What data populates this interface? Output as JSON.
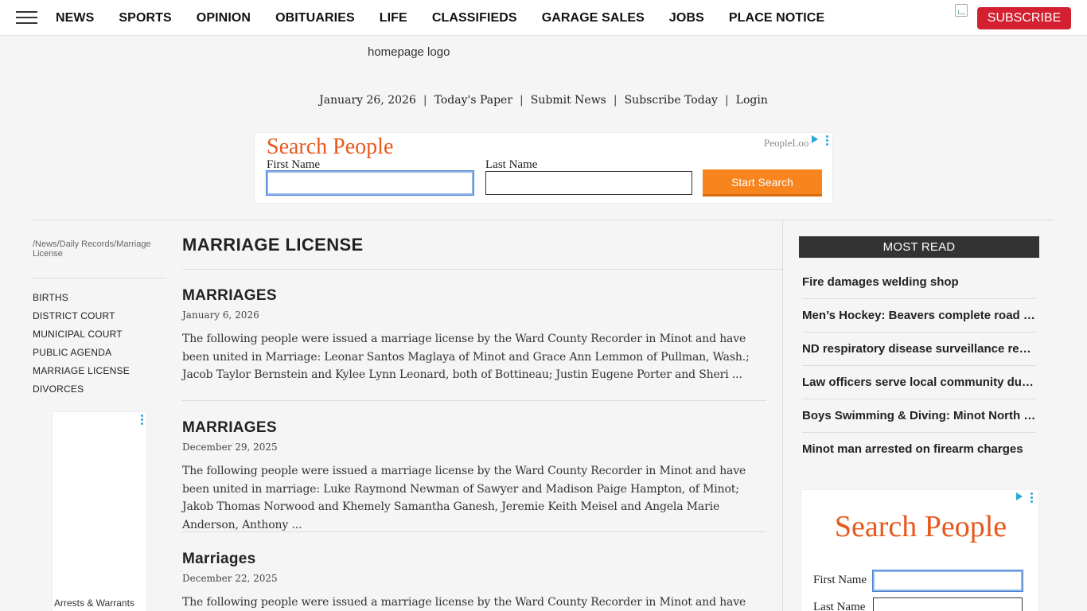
{
  "nav": {
    "items": [
      "NEWS",
      "SPORTS",
      "OPINION",
      "OBITUARIES",
      "LIFE",
      "CLASSIFIEDS",
      "GARAGE SALES",
      "JOBS",
      "PLACE NOTICE"
    ],
    "subscribe_label": "SUBSCRIBE"
  },
  "logo_alt": "homepage logo",
  "dateline": {
    "date": "January 26, 2026",
    "links": [
      "Today's Paper",
      "Submit News",
      "Subscribe Today",
      "Login"
    ]
  },
  "top_ad": {
    "title": "Search People",
    "brand": "PeopleLoo",
    "first_name_label": "First Name",
    "last_name_label": "Last Name",
    "first_name_value": "",
    "last_name_value": "",
    "button_label": "Start Search"
  },
  "breadcrumb": [
    "/News",
    "/Daily Records",
    "/Marriage License"
  ],
  "sidebar": {
    "items": [
      "BIRTHS",
      "DISTRICT COURT",
      "MUNICIPAL COURT",
      "PUBLIC AGENDA",
      "MARRIAGE LICENSE",
      "DIVORCES"
    ],
    "ad_caption": "Arrests & Warrants"
  },
  "page_title": "MARRIAGE LICENSE",
  "articles": [
    {
      "title": "MARRIAGES",
      "date": "January 6, 2026",
      "excerpt": "The following people were issued a marriage license by the Ward County Recorder in Minot and have been united in Marriage: Leonar Santos Maglaya of Minot and Grace Ann Lemmon of Pullman, Wash.; Jacob Taylor Bernstein and Kylee Lynn Leonard, both of Bottineau; Justin Eugene Porter and Sheri ..."
    },
    {
      "title": "MARRIAGES",
      "date": "December 29, 2025",
      "excerpt": "The following people were issued a marriage license by the Ward County Recorder in Minot and have been united in marriage: Luke Raymond Newman of Sawyer and Madison Paige Hampton, of Minot; Jakob Thomas Norwood and Khemely Samantha Ganesh, Jeremie Keith Meisel and Angela Marie Anderson, Anthony ..."
    },
    {
      "title": "Marriages",
      "date": "December 22, 2025",
      "excerpt": "The following people were issued a marriage license by the Ward County Recorder in Minot and have been"
    }
  ],
  "most_read": {
    "heading": "MOST READ",
    "items": [
      "Fire damages welding shop",
      "Men’s Hockey: Beavers complete road sweep",
      "ND respiratory disease surveillance report",
      "Law officers serve local community during holidays",
      "Boys Swimming & Diving: Minot North takes title",
      "Minot man arrested on firearm charges"
    ]
  },
  "right_ad": {
    "title": "Search People",
    "first_name_label": "First Name",
    "last_name_label": "Last Name"
  },
  "colors": {
    "subscribe": "#d22030",
    "ad_title": "#e8581c",
    "ad_button": "#f7841c",
    "most_read_bg": "#333333"
  }
}
